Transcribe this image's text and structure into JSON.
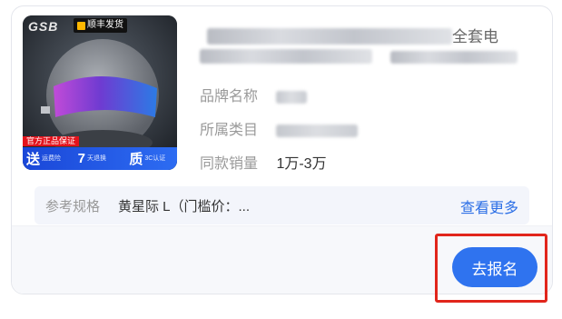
{
  "product": {
    "title_visible_fragment": "全套电",
    "thumbnail": {
      "brand_logo": "GSB",
      "ship_badge": "顺丰发货",
      "official_tag": "官方正品保证",
      "promos": [
        {
          "big": "送",
          "small": "运费险"
        },
        {
          "big": "7",
          "small": "天退换"
        },
        {
          "big": "质",
          "small": "3C认证"
        }
      ]
    },
    "fields": [
      {
        "label": "品牌名称",
        "value": ""
      },
      {
        "label": "所属类目",
        "value": ""
      },
      {
        "label": "同款销量",
        "value": "1万-3万"
      }
    ]
  },
  "spec": {
    "label": "参考规格",
    "value": "黄星际 L（门槛价：...",
    "more_link": "查看更多"
  },
  "actions": {
    "signup_label": "去报名"
  },
  "colors": {
    "accent": "#2f73ef",
    "link": "#2c6fe6",
    "highlight": "#e1251b"
  }
}
